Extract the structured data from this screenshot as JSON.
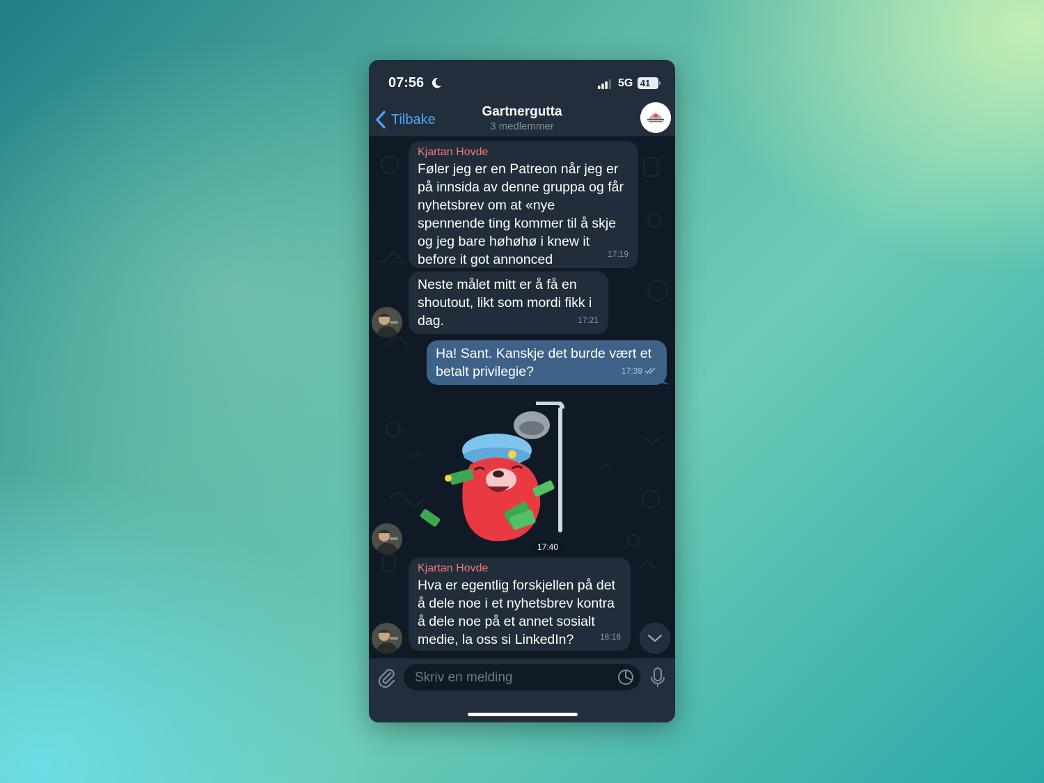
{
  "status_bar": {
    "time": "07:56",
    "network": "5G",
    "battery": "41",
    "moon_icon": "moon-icon",
    "signal_icon": "signal-bars-icon"
  },
  "header": {
    "back_label": "Tilbake",
    "title": "Gartnergutta",
    "subtitle": "3 medlemmer"
  },
  "messages": [
    {
      "sender": "Kjartan Hovde",
      "text": "Føler jeg er en Patreon når jeg er\npå innsida av denne gruppa og får\nnyhetsbrev om at «nye\nspennende ting kommer til å skje\nog jeg bare høhøhø i knew it\nbefore it got annonced",
      "time": "17:19",
      "direction": "incoming"
    },
    {
      "text": "Neste målet mitt er å få en\nshoutout, likt som mordi fikk i\ndag.",
      "time": "17:21",
      "direction": "incoming"
    },
    {
      "text": "Ha! Sant. Kanskje det burde vært et\nbetalt privilegie?",
      "time": "17:39",
      "direction": "outgoing",
      "status": "read"
    },
    {
      "type": "sticker",
      "time": "17:40",
      "direction": "incoming"
    },
    {
      "sender": "Kjartan Hovde",
      "text": "Hva er egentlig forskjellen på det\nå dele noe i et nyhetsbrev kontra\nå dele noe på et annet sosialt\nmedie, la oss si LinkedIn?",
      "time": "18:16",
      "direction": "incoming"
    }
  ],
  "composer": {
    "placeholder": "Skriv en melding"
  },
  "colors": {
    "accent": "#4fa6f3",
    "sender_name": "#f07a73",
    "incoming_bubble": "#212d3b",
    "outgoing_bubble": "#3e6188",
    "chat_background": "#0f1a26",
    "bar_background": "#232e3c"
  }
}
